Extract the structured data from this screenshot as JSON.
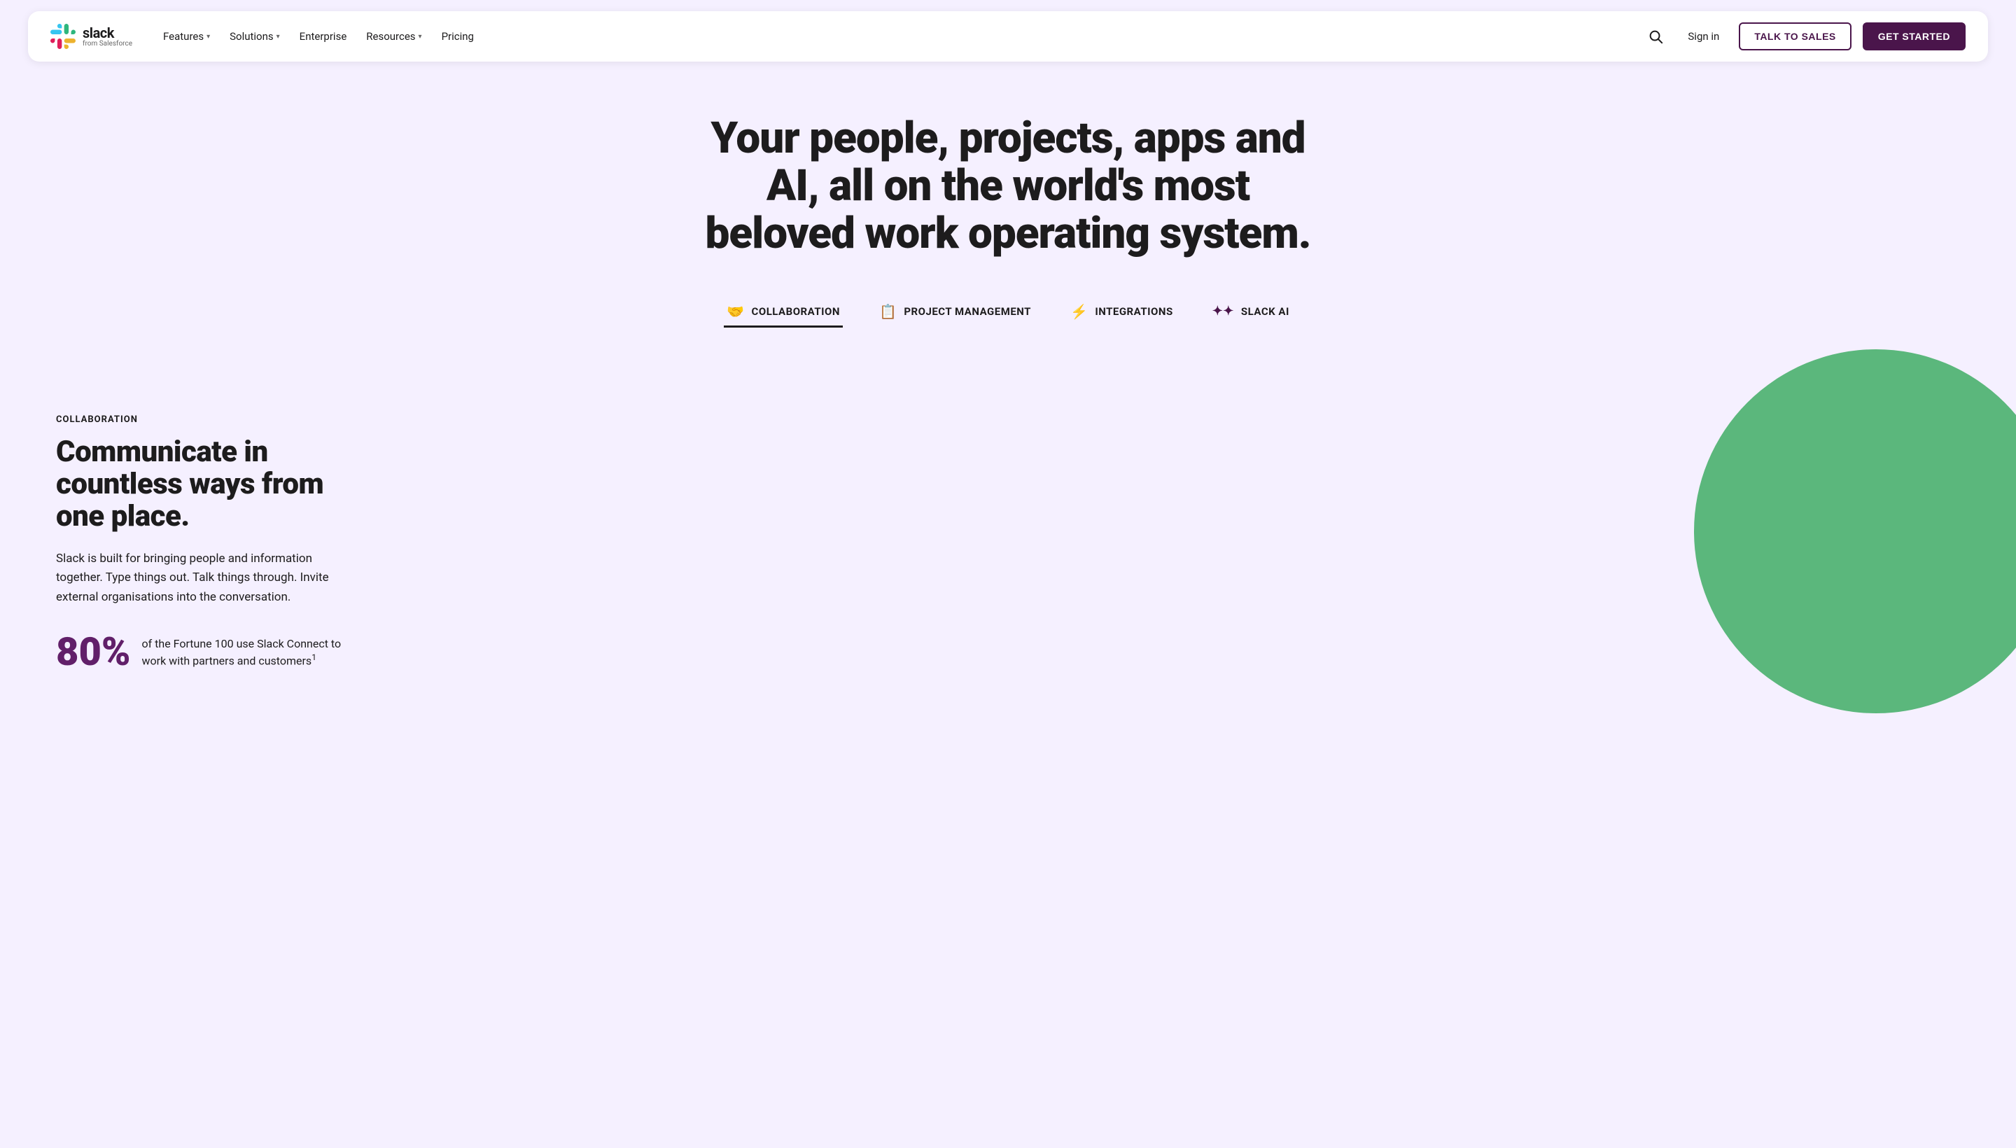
{
  "nav": {
    "logo_alt": "Slack from Salesforce",
    "slack_text": "slack",
    "from_text": "from Salesforce",
    "links": [
      {
        "label": "Features",
        "has_dropdown": true
      },
      {
        "label": "Solutions",
        "has_dropdown": true
      },
      {
        "label": "Enterprise",
        "has_dropdown": false
      },
      {
        "label": "Resources",
        "has_dropdown": true
      },
      {
        "label": "Pricing",
        "has_dropdown": false
      }
    ],
    "sign_in": "Sign in",
    "talk_to_sales": "TALK TO SALES",
    "get_started": "GET STARTED"
  },
  "hero": {
    "title": "Your people, projects, apps and AI, all on the world's most beloved work operating system."
  },
  "feature_tabs": [
    {
      "id": "collaboration",
      "label": "COLLABORATION",
      "icon": "hand"
    },
    {
      "id": "project_management",
      "label": "PROJECT MANAGEMENT",
      "icon": "clipboard"
    },
    {
      "id": "integrations",
      "label": "INTEGRATIONS",
      "icon": "lightning"
    },
    {
      "id": "slack_ai",
      "label": "SLACK AI",
      "icon": "sparkles"
    }
  ],
  "collaboration_section": {
    "label": "COLLABORATION",
    "heading": "Communicate in countless ways from one place.",
    "body": "Slack is built for bringing people and information together. Type things out. Talk things through. Invite external organisations into the conversation.",
    "stat": {
      "number": "80%",
      "description": "of the Fortune 100 use Slack Connect to work with partners and customers",
      "superscript": "1"
    }
  },
  "colors": {
    "accent_purple": "#4a154b",
    "accent_purple_light": "#611f69",
    "green_circle": "#5bb77c",
    "background": "#f5f0ff"
  }
}
